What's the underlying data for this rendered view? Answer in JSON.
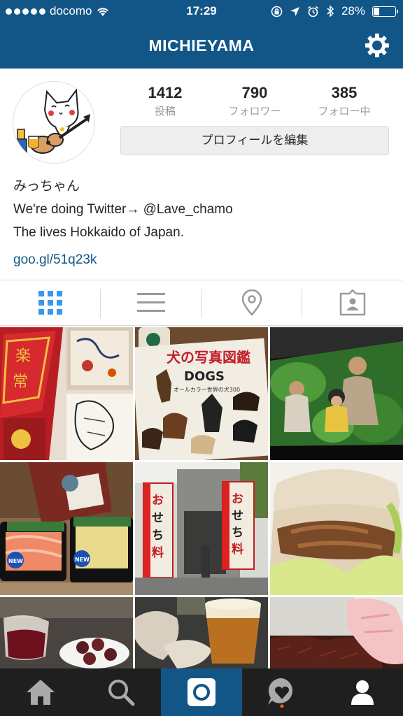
{
  "status": {
    "carrier": "docomo",
    "time": "17:29",
    "battery": "28%",
    "battery_level": 0.28
  },
  "nav": {
    "title": "MICHIEYAMA",
    "settings_icon": "gear-icon"
  },
  "profile": {
    "stats": [
      {
        "value": "1412",
        "label": "投稿"
      },
      {
        "value": "790",
        "label": "フォロワー"
      },
      {
        "value": "385",
        "label": "フォロー中"
      }
    ],
    "edit_button": "プロフィールを編集",
    "name": "みっちゃん",
    "bio_line1": "We're doing Twitter→ @Lave_chamo",
    "bio_line2": "The lives Hokkaido of Japan.",
    "link": "goo.gl/51q23k"
  },
  "tabs": [
    "grid-icon",
    "list-icon",
    "location-pin-icon",
    "tagged-photos-icon"
  ],
  "grid_text": {
    "dogs_title": "犬の写真図鑑",
    "dogs_en": "DOGS",
    "dogs_sub": "オールカラー世界の犬300",
    "osechi": "おせち料理",
    "new_badge": "NEW"
  },
  "bottom_tabs": [
    "home-icon",
    "search-icon",
    "camera-icon",
    "activity-icon",
    "profile-icon"
  ],
  "colors": {
    "brand": "#125688",
    "bottom_bar": "#1f1f1f",
    "link": "#125688",
    "grid_tab_active": "#3897f0"
  }
}
